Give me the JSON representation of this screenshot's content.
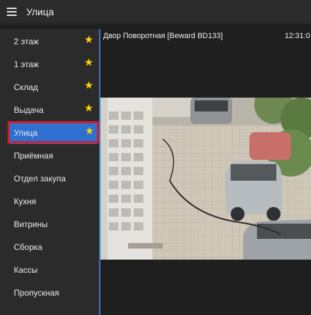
{
  "app": {
    "title": "Улица"
  },
  "sidebar": {
    "items": [
      {
        "label": "2 этаж",
        "favorite": true
      },
      {
        "label": "1 этаж",
        "favorite": true
      },
      {
        "label": "Склад",
        "favorite": true
      },
      {
        "label": "Выдача",
        "favorite": true
      },
      {
        "label": "Улица",
        "favorite": true,
        "selected": true
      },
      {
        "label": "Приёмная",
        "favorite": false
      },
      {
        "label": "Отдел закупа",
        "favorite": false
      },
      {
        "label": "Кухня",
        "favorite": false
      },
      {
        "label": "Витрины",
        "favorite": false
      },
      {
        "label": "Сборка",
        "favorite": false
      },
      {
        "label": "Кассы",
        "favorite": false
      },
      {
        "label": "Пропускная",
        "favorite": false
      }
    ],
    "star_glyph": "★"
  },
  "camera": {
    "name": "Двор Поворотная [Beward BD133]",
    "time": "12:31:0"
  },
  "colors": {
    "accent": "#2e6fd0",
    "highlight_border": "#d61b24",
    "star": "#ffd400",
    "background": "#1f1f1f",
    "panel": "#2b2b2b"
  },
  "icons": [
    "hamburger-menu-icon",
    "star-icon"
  ]
}
